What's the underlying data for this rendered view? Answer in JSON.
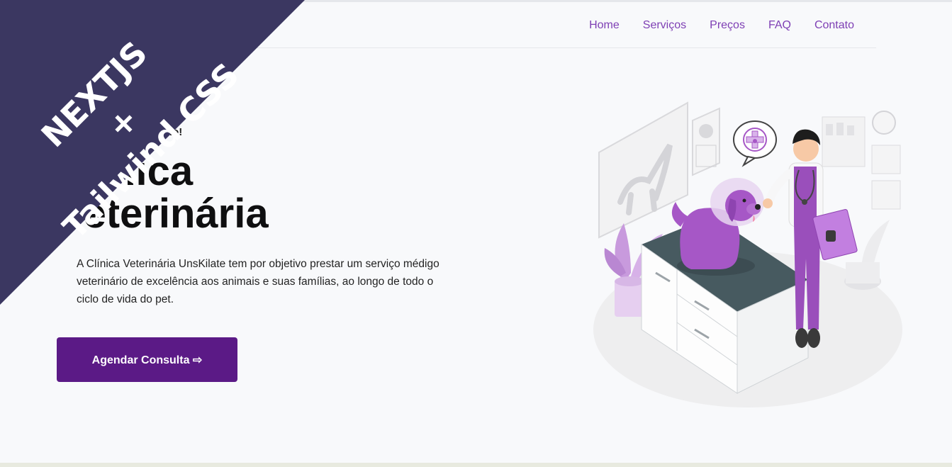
{
  "nav": {
    "items": [
      {
        "label": "Home"
      },
      {
        "label": "Serviços"
      },
      {
        "label": "Preços"
      },
      {
        "label": "FAQ"
      },
      {
        "label": "Contato"
      }
    ]
  },
  "hero": {
    "tagline": "tratado com carinho!",
    "title_line1": "Clínica",
    "title_line2": "Veterinária",
    "description": "A Clínica Veterinária UnsKilate tem por objetivo prestar um serviço médigo veterinário de excelência aos animais e suas famílias, ao longo de todo o ciclo de vida do pet.",
    "cta_label": "Agendar Consulta ⇨"
  },
  "banner": {
    "line1": "NEXTJS",
    "line2": "+",
    "line3": "Tailwind CSS"
  },
  "colors": {
    "accent": "#7e3fb4",
    "button": "#5b1a86",
    "banner": "#3b3761",
    "illustration_purple": "#a657c6"
  }
}
